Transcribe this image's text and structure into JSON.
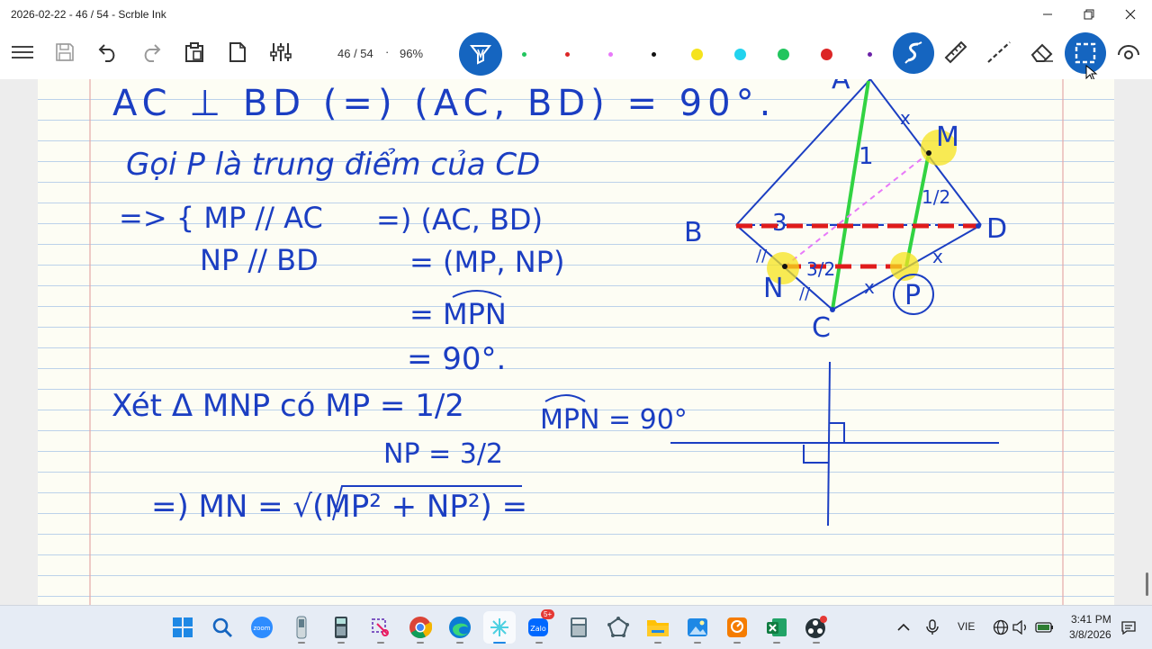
{
  "window": {
    "title": "2026-02-22 - 46 / 54 - Scrble Ink",
    "controls": [
      "minimize",
      "restore",
      "close"
    ]
  },
  "toolbar": {
    "page_indicator": "46 / 54",
    "separator": "·",
    "zoom": "96%",
    "tools": [
      "menu-icon",
      "save-icon",
      "undo-icon",
      "redo-icon",
      "clipboard-icon",
      "page-icon",
      "adjust-icon",
      "pen-tool-icon",
      "highlighter-tool-icon",
      "ruler-icon",
      "dashed-line-icon",
      "eraser-icon",
      "selection-icon",
      "view-icon"
    ],
    "active_tools": [
      "pen-tool",
      "selection-tool"
    ],
    "color_dots": [
      {
        "name": "color-green-small",
        "color": "#22c55e",
        "size": "small"
      },
      {
        "name": "color-red-small",
        "color": "#dc2626",
        "size": "small"
      },
      {
        "name": "color-pink-small",
        "color": "#e879f9",
        "size": "small"
      },
      {
        "name": "color-black-small",
        "color": "#111111",
        "size": "small"
      },
      {
        "name": "color-yellow",
        "color": "#f5e31d",
        "size": "large"
      },
      {
        "name": "color-cyan",
        "color": "#22d3ee",
        "size": "large"
      },
      {
        "name": "color-green",
        "color": "#22c55e",
        "size": "large"
      },
      {
        "name": "color-red",
        "color": "#dc2626",
        "size": "large"
      },
      {
        "name": "color-purple-small",
        "color": "#6b21a8",
        "size": "small"
      }
    ],
    "accent_color": "#1565c0"
  },
  "notes": {
    "line1": "AC ⊥ BD (=) (AC, BD) = 90°.",
    "line2": "Gọi P là trung điểm của CD",
    "line3a": "=> { MP // AC",
    "line3b": "NP // BD",
    "line3c": "=) (AC, BD)",
    "line4": "= (MP, NP)",
    "line5": "= MPN",
    "line6": "= 90°.",
    "line7": "Xét Δ MNP có MP = 1/2",
    "line7b": "MPN = 90°",
    "line8": "NP = 3/2",
    "line9": "=) MN = √(MP² + NP²) =",
    "figure_labels": [
      "A",
      "B",
      "C",
      "D",
      "M",
      "N",
      "P",
      "1",
      "3",
      "1/2",
      "3/2",
      "x",
      "x",
      "x",
      "//",
      "//"
    ]
  },
  "taskbar": {
    "apps": [
      "start-icon",
      "search-icon",
      "zoom-app-icon",
      "phone-app-icon",
      "calculator-device-icon",
      "snipping-icon",
      "chrome-icon",
      "edge-icon",
      "scrble-ink-icon",
      "zalo-icon",
      "calculator-icon",
      "network-app-icon",
      "file-explorer-icon",
      "photos-icon",
      "presenter-icon",
      "excel-icon",
      "obs-icon"
    ],
    "zalo_badge": "5+",
    "language": "VIE",
    "time": "3:41 PM",
    "date": "3/8/2026"
  }
}
